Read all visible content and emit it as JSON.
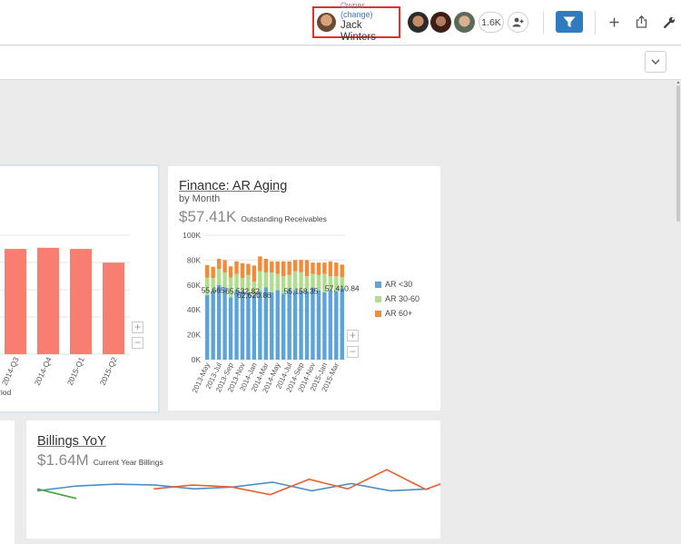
{
  "header": {
    "owner_label": "Owner",
    "owner_change": "(change)",
    "owner_name": "Jack Winters",
    "viewer_count": "1.6K"
  },
  "colors": {
    "accent": "#2f7bc0",
    "ar_lt30": "#5ba3d8",
    "ar_30_60": "#b0dd8d",
    "ar_60plus": "#f28a38",
    "bar_coral": "#f97e72",
    "billings_blue": "#4a90c8",
    "billings_orange": "#e8602c",
    "billings_green": "#4aa33a"
  },
  "left_chart": {
    "categories": [
      "2014-Q3",
      "2014-Q4",
      "2015-Q1",
      "2015-Q2"
    ],
    "values": [
      0.92,
      0.93,
      0.92,
      0.8
    ],
    "axis_fragment": "riod"
  },
  "ar_card": {
    "title": "Finance: AR Aging",
    "subtitle": "by Month",
    "kpi_value": "$57.41K",
    "kpi_label": "Outstanding Receivables",
    "legend": [
      "AR <30",
      "AR 30-60",
      "AR 60+"
    ],
    "chart_data": {
      "type": "bar",
      "stacked": true,
      "ylim": [
        0,
        100000
      ],
      "yticks": [
        "0K",
        "20K",
        "40K",
        "60K",
        "80K",
        "100K"
      ],
      "x_tick_labels": [
        "2013-May",
        "2013-Jul",
        "2013-Sep",
        "2013-Nov",
        "2014-Jan",
        "2014-Mar",
        "2014-May",
        "2014-Jul",
        "2014-Sep",
        "2014-Nov",
        "2015-Jan",
        "2015-Mar"
      ],
      "data_labels": [
        {
          "text": "55,665",
          "bar": 1
        },
        {
          "text": "65,532.82",
          "bar": 6
        },
        {
          "text": "62,620.86",
          "bar": 8
        },
        {
          "text": "55,158.35",
          "bar": 16
        },
        {
          "text": "57,410.84",
          "bar": 23
        }
      ],
      "series": [
        {
          "name": "AR <30",
          "values": [
            52000,
            55665,
            60000,
            58000,
            50000,
            56000,
            55000,
            54000,
            52000,
            55000,
            58000,
            54000,
            56000,
            53000,
            57000,
            56000,
            55158,
            55000,
            58000,
            56000,
            54000,
            56000,
            55000,
            57411
          ]
        },
        {
          "name": "AR 30-60",
          "values": [
            14000,
            10000,
            13000,
            12000,
            16000,
            13000,
            10533,
            14000,
            10621,
            16000,
            12000,
            16000,
            13000,
            14000,
            11000,
            15000,
            15000,
            12000,
            11000,
            12000,
            15000,
            11000,
            12000,
            9000
          ]
        },
        {
          "name": "AR 60+",
          "values": [
            10000,
            9000,
            8000,
            10000,
            9000,
            10000,
            12000,
            9000,
            13000,
            12000,
            11000,
            9000,
            10000,
            12000,
            11000,
            9000,
            10000,
            13000,
            9000,
            10000,
            9000,
            12000,
            11000,
            10000
          ]
        }
      ]
    }
  },
  "billings_card": {
    "title": "Billings YoY",
    "kpi_value": "$1.64M",
    "kpi_label": "Current Year Billings",
    "chart_data": {
      "type": "line",
      "series": [
        {
          "name": "blue",
          "x": [
            0,
            1,
            2,
            3,
            4,
            5,
            6,
            7,
            8,
            9,
            10
          ],
          "y": [
            0.52,
            0.62,
            0.66,
            0.64,
            0.56,
            0.6,
            0.7,
            0.52,
            0.67,
            0.52,
            0.56
          ]
        },
        {
          "name": "orange",
          "x": [
            3,
            4,
            5,
            6,
            7,
            8,
            9,
            10
          ],
          "y": [
            0.56,
            0.64,
            0.6,
            0.44,
            0.76,
            0.56,
            0.96,
            0.55,
            0.84
          ]
        },
        {
          "name": "green",
          "x": [
            0,
            1
          ],
          "y": [
            0.56,
            0.36
          ]
        }
      ]
    }
  }
}
